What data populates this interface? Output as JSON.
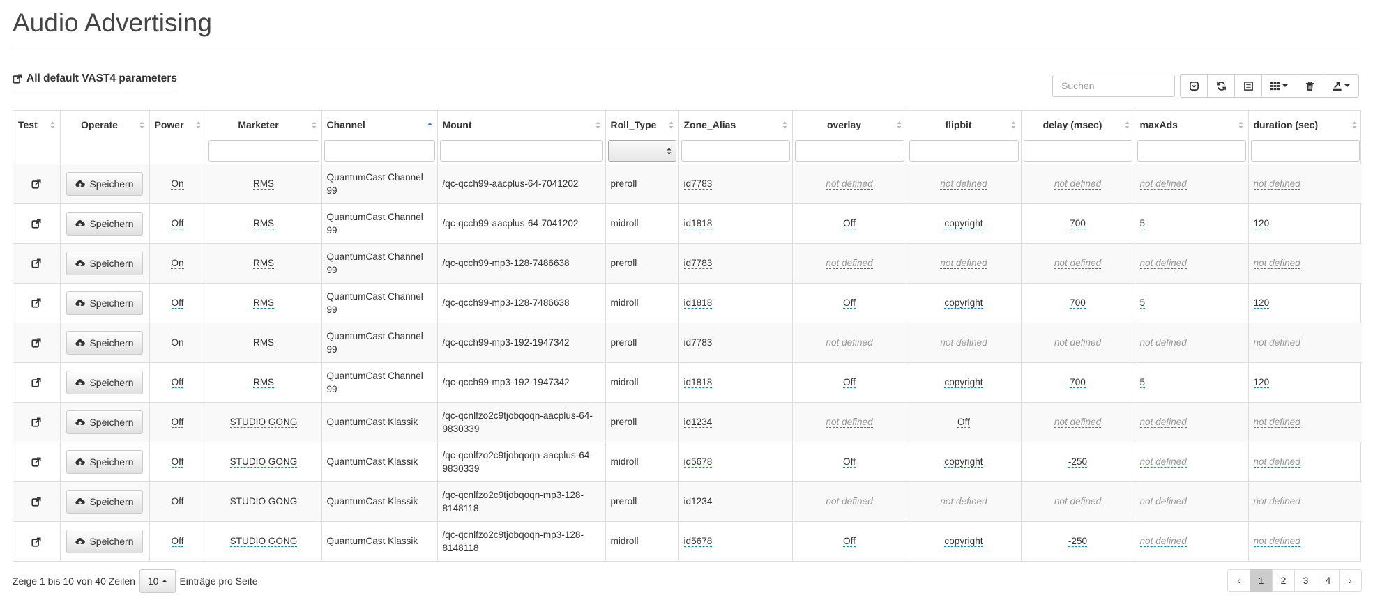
{
  "page": {
    "title": "Audio Advertising"
  },
  "vast_link": {
    "label": "All default VAST4 parameters",
    "icon": "external-link-icon"
  },
  "toolbar": {
    "search_placeholder": "Suchen",
    "buttons": [
      {
        "name": "toggle-button",
        "icon": "toggle-icon"
      },
      {
        "name": "refresh-button",
        "icon": "refresh-icon"
      },
      {
        "name": "toggle-view-button",
        "icon": "list-icon"
      },
      {
        "name": "columns-button",
        "icon": "columns-icon"
      },
      {
        "name": "delete-button",
        "icon": "trash-icon"
      },
      {
        "name": "export-button",
        "icon": "export-icon"
      }
    ]
  },
  "columns": [
    {
      "key": "test",
      "label": "Test",
      "align": "left"
    },
    {
      "key": "operate",
      "label": "Operate",
      "align": "center"
    },
    {
      "key": "power",
      "label": "Power",
      "align": "left"
    },
    {
      "key": "marketer",
      "label": "Marketer",
      "align": "center"
    },
    {
      "key": "channel",
      "label": "Channel",
      "align": "left",
      "sorted": "asc"
    },
    {
      "key": "mount",
      "label": "Mount",
      "align": "left"
    },
    {
      "key": "roll_type",
      "label": "Roll_Type",
      "align": "left"
    },
    {
      "key": "zone_alias",
      "label": "Zone_Alias",
      "align": "left"
    },
    {
      "key": "overlay",
      "label": "overlay",
      "align": "center"
    },
    {
      "key": "flipbit",
      "label": "flipbit",
      "align": "center"
    },
    {
      "key": "delay",
      "label": "delay (msec)",
      "align": "center"
    },
    {
      "key": "maxads",
      "label": "maxAds",
      "align": "left"
    },
    {
      "key": "duration",
      "label": "duration (sec)",
      "align": "left"
    }
  ],
  "save_label": "Speichern",
  "rows": [
    {
      "power": "On",
      "marketer": "RMS",
      "channel": "QuantumCast Channel 99",
      "mount": "/qc-qcch99-aacplus-64-7041202",
      "roll_type": "preroll",
      "zone_alias": "id7783",
      "overlay": "not defined",
      "flipbit": "not defined",
      "delay": "not defined",
      "maxads": "not defined",
      "duration": "not defined"
    },
    {
      "power": "Off",
      "marketer": "RMS",
      "channel": "QuantumCast Channel 99",
      "mount": "/qc-qcch99-aacplus-64-7041202",
      "roll_type": "midroll",
      "zone_alias": "id1818",
      "overlay": "Off",
      "flipbit": "copyright",
      "delay": "700",
      "maxads": "5",
      "duration": "120"
    },
    {
      "power": "On",
      "marketer": "RMS",
      "channel": "QuantumCast Channel 99",
      "mount": "/qc-qcch99-mp3-128-7486638",
      "roll_type": "preroll",
      "zone_alias": "id7783",
      "overlay": "not defined",
      "flipbit": "not defined",
      "delay": "not defined",
      "maxads": "not defined",
      "duration": "not defined"
    },
    {
      "power": "Off",
      "marketer": "RMS",
      "channel": "QuantumCast Channel 99",
      "mount": "/qc-qcch99-mp3-128-7486638",
      "roll_type": "midroll",
      "zone_alias": "id1818",
      "overlay": "Off",
      "flipbit": "copyright",
      "delay": "700",
      "maxads": "5",
      "duration": "120"
    },
    {
      "power": "On",
      "marketer": "RMS",
      "channel": "QuantumCast Channel 99",
      "mount": "/qc-qcch99-mp3-192-1947342",
      "roll_type": "preroll",
      "zone_alias": "id7783",
      "overlay": "not defined",
      "flipbit": "not defined",
      "delay": "not defined",
      "maxads": "not defined",
      "duration": "not defined"
    },
    {
      "power": "Off",
      "marketer": "RMS",
      "channel": "QuantumCast Channel 99",
      "mount": "/qc-qcch99-mp3-192-1947342",
      "roll_type": "midroll",
      "zone_alias": "id1818",
      "overlay": "Off",
      "flipbit": "copyright",
      "delay": "700",
      "maxads": "5",
      "duration": "120"
    },
    {
      "power": "Off",
      "marketer": "STUDIO GONG",
      "channel": "QuantumCast Klassik",
      "mount": "/qc-qcnlfzo2c9tjobqoqn-aacplus-64-9830339",
      "roll_type": "preroll",
      "zone_alias": "id1234",
      "overlay": "not defined",
      "flipbit": "Off",
      "delay": "not defined",
      "maxads": "not defined",
      "duration": "not defined"
    },
    {
      "power": "Off",
      "marketer": "STUDIO GONG",
      "channel": "QuantumCast Klassik",
      "mount": "/qc-qcnlfzo2c9tjobqoqn-aacplus-64-9830339",
      "roll_type": "midroll",
      "zone_alias": "id5678",
      "overlay": "Off",
      "flipbit": "copyright",
      "delay": "-250",
      "maxads": "not defined",
      "duration": "not defined"
    },
    {
      "power": "Off",
      "marketer": "STUDIO GONG",
      "channel": "QuantumCast Klassik",
      "mount": "/qc-qcnlfzo2c9tjobqoqn-mp3-128-8148118",
      "roll_type": "preroll",
      "zone_alias": "id1234",
      "overlay": "not defined",
      "flipbit": "not defined",
      "delay": "not defined",
      "maxads": "not defined",
      "duration": "not defined"
    },
    {
      "power": "Off",
      "marketer": "STUDIO GONG",
      "channel": "QuantumCast Klassik",
      "mount": "/qc-qcnlfzo2c9tjobqoqn-mp3-128-8148118",
      "roll_type": "midroll",
      "zone_alias": "id5678",
      "overlay": "Off",
      "flipbit": "copyright",
      "delay": "-250",
      "maxads": "not defined",
      "duration": "not defined"
    }
  ],
  "footer": {
    "showing": "Zeige 1 bis 10 von 40 Zeilen",
    "page_size": "10",
    "per_page": "Einträge pro Seite"
  },
  "pagination": {
    "prev": "‹",
    "pages": [
      "1",
      "2",
      "3",
      "4"
    ],
    "active": "1",
    "next": "›"
  }
}
